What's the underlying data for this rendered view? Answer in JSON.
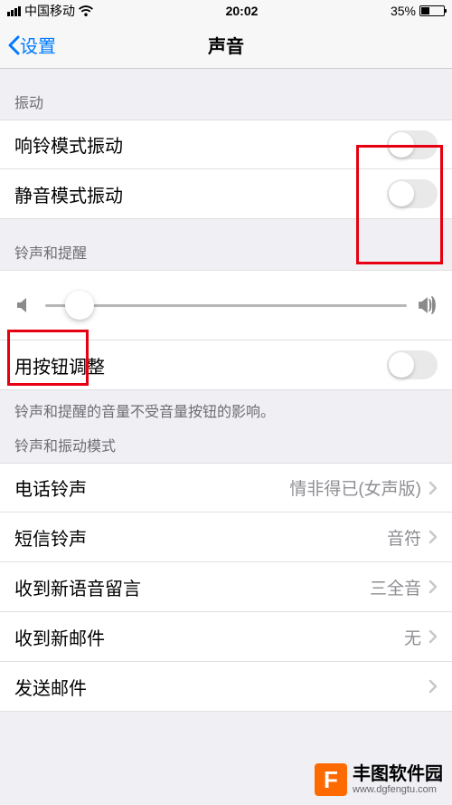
{
  "status": {
    "carrier": "中国移动",
    "time": "20:02",
    "battery": "35%"
  },
  "nav": {
    "back": "设置",
    "title": "声音"
  },
  "sections": {
    "vibration": {
      "header": "振动",
      "ringMode": "响铃模式振动",
      "silentMode": "静音模式振动"
    },
    "ringer": {
      "header": "铃声和提醒",
      "changeWithButtons": "用按钮调整",
      "footer": "铃声和提醒的音量不受音量按钮的影响。"
    },
    "sounds": {
      "header": "铃声和振动模式",
      "ringtone": {
        "label": "电话铃声",
        "value": "情非得已(女声版)"
      },
      "textTone": {
        "label": "短信铃声",
        "value": "音符"
      },
      "voicemail": {
        "label": "收到新语音留言",
        "value": "三全音"
      },
      "newMail": {
        "label": "收到新邮件",
        "value": "无"
      },
      "sentMail": {
        "label": "发送邮件",
        "value": ""
      }
    }
  },
  "watermark": {
    "name": "丰图软件园",
    "url": "www.dgfengtu.com"
  }
}
